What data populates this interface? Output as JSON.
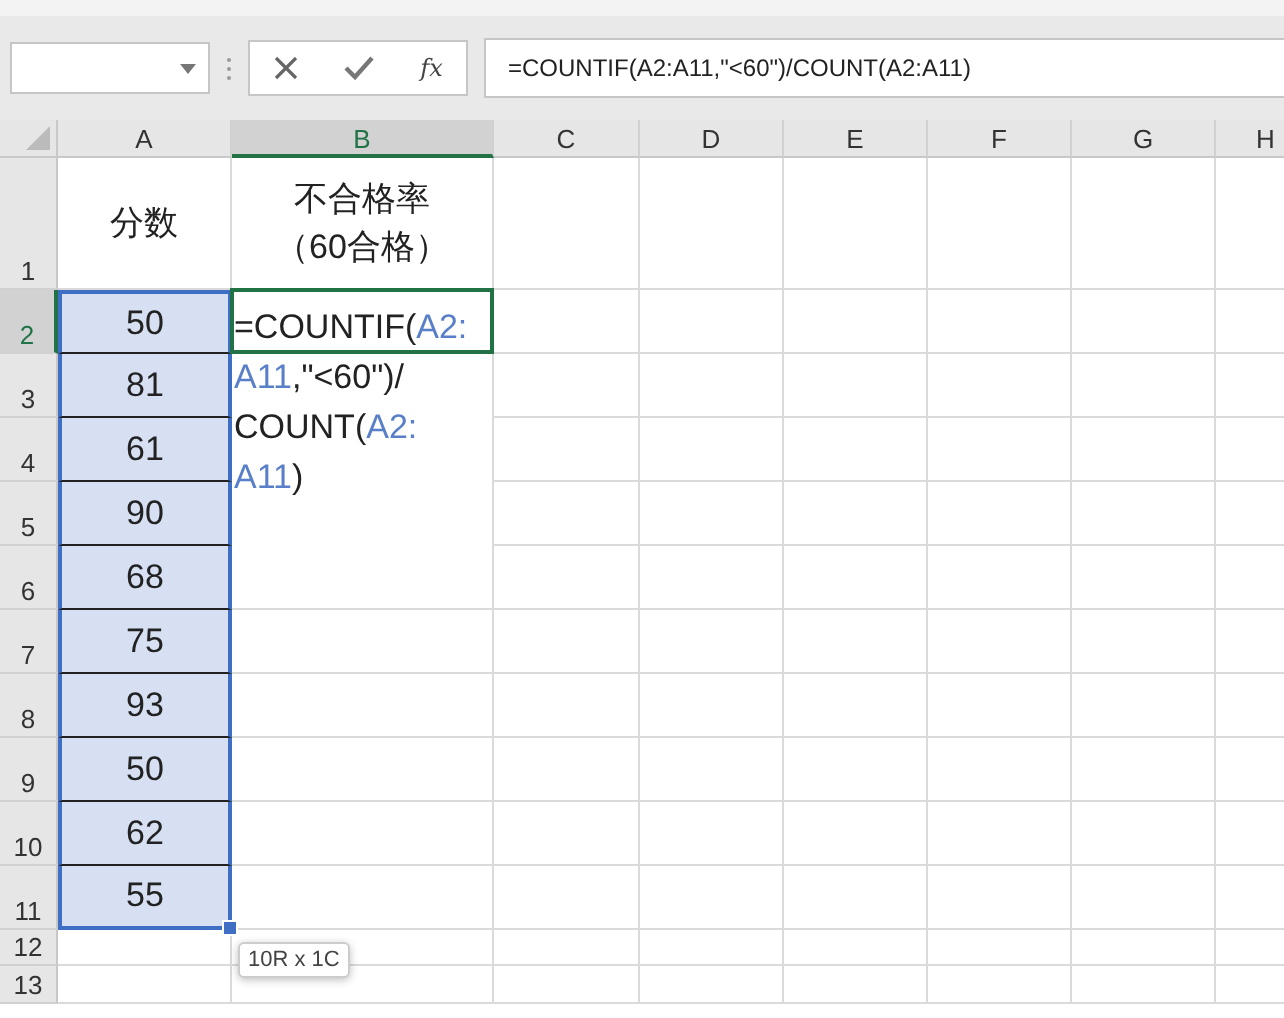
{
  "formula_bar": {
    "function_label": "fx",
    "formula": "=COUNTIF(A2:A11,\"<60\")/COUNT(A2:A11)"
  },
  "columns": [
    {
      "label": "A",
      "selected": false
    },
    {
      "label": "B",
      "selected": true
    },
    {
      "label": "C",
      "selected": false
    },
    {
      "label": "D",
      "selected": false
    },
    {
      "label": "E",
      "selected": false
    },
    {
      "label": "F",
      "selected": false
    },
    {
      "label": "G",
      "selected": false
    },
    {
      "label": "H",
      "selected": false
    }
  ],
  "rows": [
    {
      "number": "1",
      "selected": false,
      "cells": [
        {
          "lines": [
            "分数"
          ],
          "in_range": false
        },
        {
          "lines": [
            "不合格率",
            "（60合格）"
          ]
        }
      ]
    },
    {
      "number": "2",
      "selected": true,
      "cells": [
        {
          "lines": [
            "50"
          ],
          "in_range": true
        }
      ]
    },
    {
      "number": "3",
      "selected": false,
      "cells": [
        {
          "lines": [
            "81"
          ],
          "in_range": true
        }
      ]
    },
    {
      "number": "4",
      "selected": false,
      "cells": [
        {
          "lines": [
            "61"
          ],
          "in_range": true
        }
      ]
    },
    {
      "number": "5",
      "selected": false,
      "cells": [
        {
          "lines": [
            "90"
          ],
          "in_range": true
        }
      ]
    },
    {
      "number": "6",
      "selected": false,
      "cells": [
        {
          "lines": [
            "68"
          ],
          "in_range": true
        }
      ]
    },
    {
      "number": "7",
      "selected": false,
      "cells": [
        {
          "lines": [
            "75"
          ],
          "in_range": true
        }
      ]
    },
    {
      "number": "8",
      "selected": false,
      "cells": [
        {
          "lines": [
            "93"
          ],
          "in_range": true
        }
      ]
    },
    {
      "number": "9",
      "selected": false,
      "cells": [
        {
          "lines": [
            "50"
          ],
          "in_range": true
        }
      ]
    },
    {
      "number": "10",
      "selected": false,
      "cells": [
        {
          "lines": [
            "62"
          ],
          "in_range": true
        }
      ]
    },
    {
      "number": "11",
      "selected": false,
      "cells": [
        {
          "lines": [
            "55"
          ],
          "in_range": true
        }
      ]
    },
    {
      "number": "12",
      "selected": false,
      "cells": []
    },
    {
      "number": "13",
      "selected": false,
      "cells": []
    }
  ],
  "editor": {
    "lines": [
      [
        {
          "text": "=COUNTIF(",
          "kind": "plain"
        },
        {
          "text": "A2:",
          "kind": "ref"
        }
      ],
      [
        {
          "text": "A11",
          "kind": "ref"
        },
        {
          "text": ",\"<60\")/",
          "kind": "plain"
        }
      ],
      [
        {
          "text": "COUNT(",
          "kind": "plain"
        },
        {
          "text": "A2:",
          "kind": "ref"
        }
      ],
      [
        {
          "text": "A11",
          "kind": "ref"
        },
        {
          "text": ")",
          "kind": "plain"
        }
      ]
    ]
  },
  "selection_tooltip": "10R x 1C"
}
